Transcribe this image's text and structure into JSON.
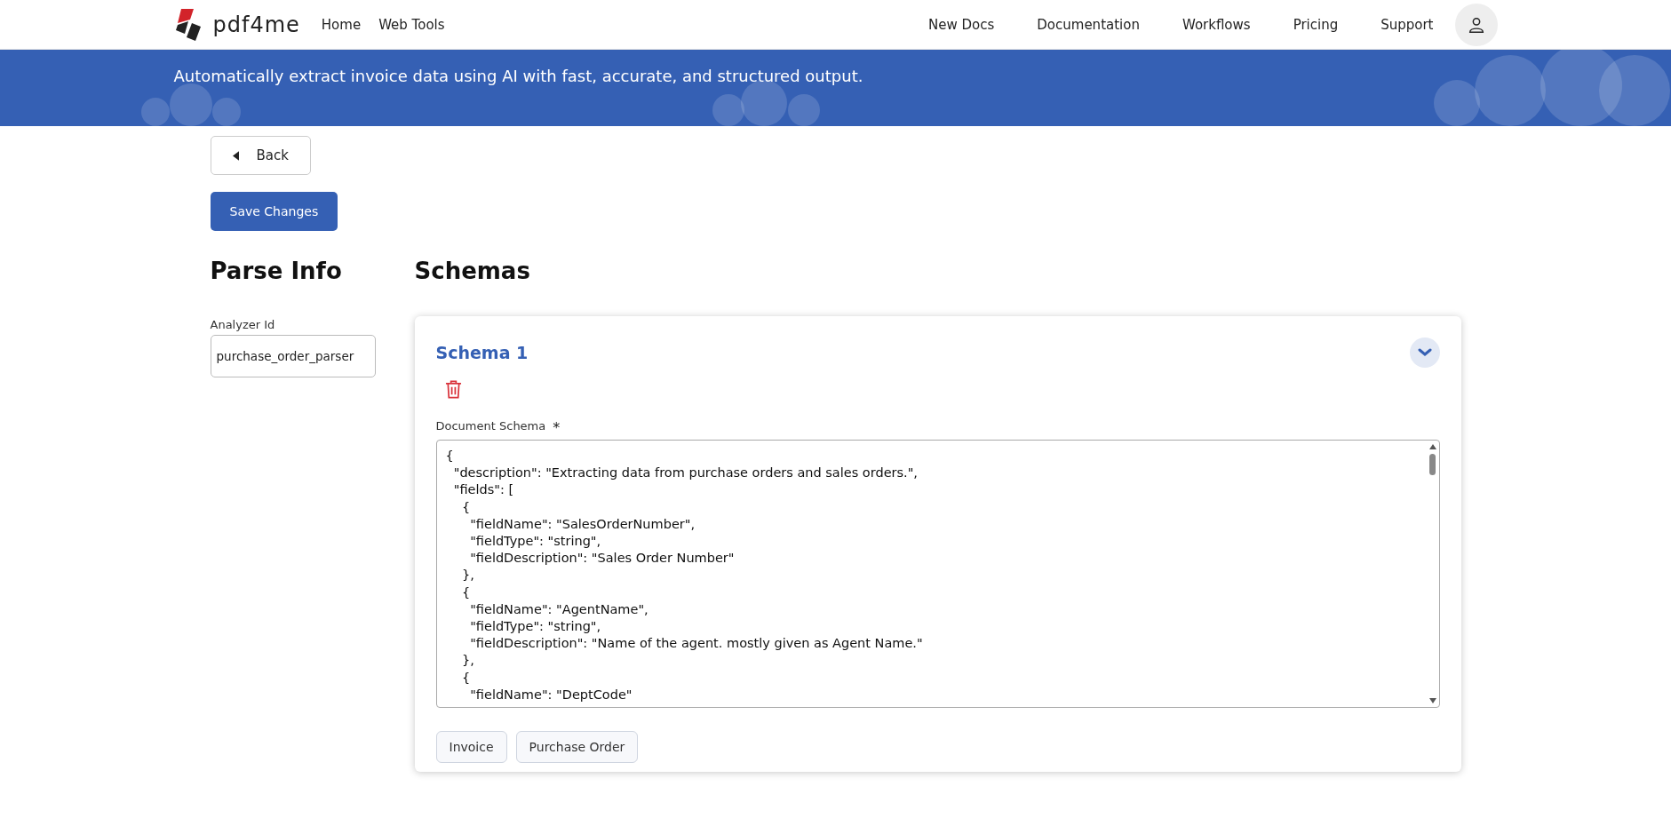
{
  "nav": {
    "logo": "pdf4me",
    "left_links": [
      "Home",
      "Web Tools"
    ],
    "right_links": [
      "New Docs",
      "Documentation",
      "Workflows",
      "Pricing",
      "Support"
    ]
  },
  "banner": {
    "text": "Automatically extract invoice data using AI with fast, accurate, and structured output."
  },
  "back_button": {
    "label": "Back"
  },
  "save_button": {
    "label": "Save Changes"
  },
  "parse_info": {
    "heading": "Parse Info",
    "analyzer_label": "Analyzer Id",
    "analyzer_value": "purchase_order_parser"
  },
  "schemas": {
    "heading": "Schemas",
    "items": [
      {
        "title": "Schema 1",
        "expanded": true,
        "field_label": "Document Schema",
        "required_mark": "*",
        "lines": [
          "{",
          "  \"description\": \"Extracting data from purchase orders and sales orders.\",",
          "  \"fields\": [",
          "    {",
          "      \"fieldName\": \"SalesOrderNumber\",",
          "      \"fieldType\": \"string\",",
          "      \"fieldDescription\": \"Sales Order Number\"",
          "    },",
          "    {",
          "      \"fieldName\": \"AgentName\",",
          "      \"fieldType\": \"string\",",
          "      \"fieldDescription\": \"Name of the agent. mostly given as Agent Name.\"",
          "    },",
          "    {",
          "      \"fieldName\": \"DeptCode\""
        ],
        "templates": [
          "Invoice",
          "Purchase Order"
        ]
      }
    ]
  }
}
